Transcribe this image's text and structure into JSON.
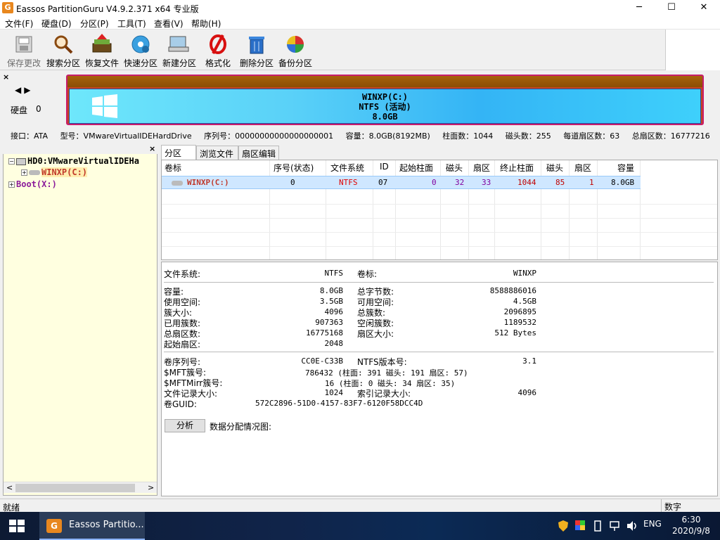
{
  "window": {
    "title": "Eassos PartitionGuru V4.9.2.371 x64 专业版",
    "minimize": "─",
    "maximize": "☐",
    "close": "✕"
  },
  "menu": [
    "文件(F)",
    "硬盘(D)",
    "分区(P)",
    "工具(T)",
    "查看(V)",
    "帮助(H)"
  ],
  "toolbar": [
    {
      "label": "保存更改",
      "icon": "save-icon",
      "enabled": false
    },
    {
      "label": "搜索分区",
      "icon": "magnifier-icon",
      "enabled": true
    },
    {
      "label": "恢复文件",
      "icon": "recover-files-icon",
      "enabled": true
    },
    {
      "label": "快速分区",
      "icon": "quick-partition-icon",
      "enabled": true
    },
    {
      "label": "新建分区",
      "icon": "new-partition-icon",
      "enabled": true
    },
    {
      "label": "格式化",
      "icon": "format-icon",
      "enabled": true
    },
    {
      "label": "删除分区",
      "icon": "trash-icon",
      "enabled": true
    },
    {
      "label": "备份分区",
      "icon": "backup-pie-icon",
      "enabled": true
    }
  ],
  "disk_panel": {
    "close": "×",
    "nav": "◀▶",
    "disk_label": "硬盘",
    "disk_index": "0",
    "partition_line1": "WINXP(C:)",
    "partition_line2": "NTFS (活动)",
    "partition_line3": "8.0GB"
  },
  "disk_info": [
    "接口：ATA",
    "型号：VMwareVirtualIDEHardDrive",
    "序列号：00000000000000000001",
    "容量：8.0GB(8192MB)",
    "柱面数：1044",
    "磁头数：255",
    "每道扇区数：63",
    "总扇区数：16777216"
  ],
  "tree": {
    "close": "×",
    "root": "HD0:VMwareVirtualIDEHa",
    "child": "WINXP(C:)",
    "boot": "Boot(X:)",
    "scroll_left": "<",
    "scroll_right": ">"
  },
  "tabs": [
    "分区",
    "浏览文件",
    "扇区编辑"
  ],
  "grid": {
    "headers": [
      "卷标",
      "序号(状态)",
      "文件系统",
      "ID",
      "起始柱面",
      "磁头",
      "扇区",
      "终止柱面",
      "磁头",
      "扇区",
      "容量"
    ],
    "row": [
      "WINXP(C:)",
      "0",
      "NTFS",
      "07",
      "0",
      "32",
      "33",
      "1044",
      "85",
      "1",
      "8.0GB"
    ]
  },
  "details": {
    "fs_label": "文件系统:",
    "fs_value": "NTFS",
    "vol_label": "卷标:",
    "vol_value": "WINXP",
    "cap_label": "容量:",
    "cap_value": "8.0GB",
    "total_bytes_label": "总字节数:",
    "total_bytes_value": "8588886016",
    "used_label": "使用空间:",
    "used_value": "3.5GB",
    "free_label": "可用空间:",
    "free_value": "4.5GB",
    "cluster_label": "簇大小:",
    "cluster_value": "4096",
    "total_clusters_label": "总簇数:",
    "total_clusters_value": "2096895",
    "used_clusters_label": "已用簇数:",
    "used_clusters_value": "907363",
    "free_clusters_label": "空闲簇数:",
    "free_clusters_value": "1189532",
    "total_sectors_label": "总扇区数:",
    "total_sectors_value": "16775168",
    "sector_size_label": "扇区大小:",
    "sector_size_value": "512 Bytes",
    "start_sector_label": "起始扇区:",
    "start_sector_value": "2048",
    "serial_label": "卷序列号:",
    "serial_value": "CC0E-C33B",
    "ntfs_ver_label": "NTFS版本号:",
    "ntfs_ver_value": "3.1",
    "mft_label": "$MFT簇号:",
    "mft_value": "786432 (柱面: 391 磁头: 191 扇区: 57)",
    "mftmirr_label": "$MFTMirr簇号:",
    "mftmirr_value": "16 (柱面: 0 磁头: 34 扇区: 35)",
    "file_record_label": "文件记录大小:",
    "file_record_value": "1024",
    "index_record_label": "索引记录大小:",
    "index_record_value": "4096",
    "guid_label": "卷GUID:",
    "guid_value": "572C2896-51D0-4157-83F7-6120F58DCC4D",
    "analyze_button": "分析",
    "alloc_label": "数据分配情况图:"
  },
  "status": {
    "left": "就绪",
    "right": "数字"
  },
  "taskbar": {
    "app_label": "Eassos Partitio...",
    "lang": "ENG",
    "time": "6:30",
    "date": "2020/9/8"
  },
  "colors": {
    "partition_name": "#c0392b",
    "boot_name": "#8b1a9a",
    "ntfs": "#e00000",
    "cyl": "#8000a0",
    "endcyl": "#c00000"
  }
}
